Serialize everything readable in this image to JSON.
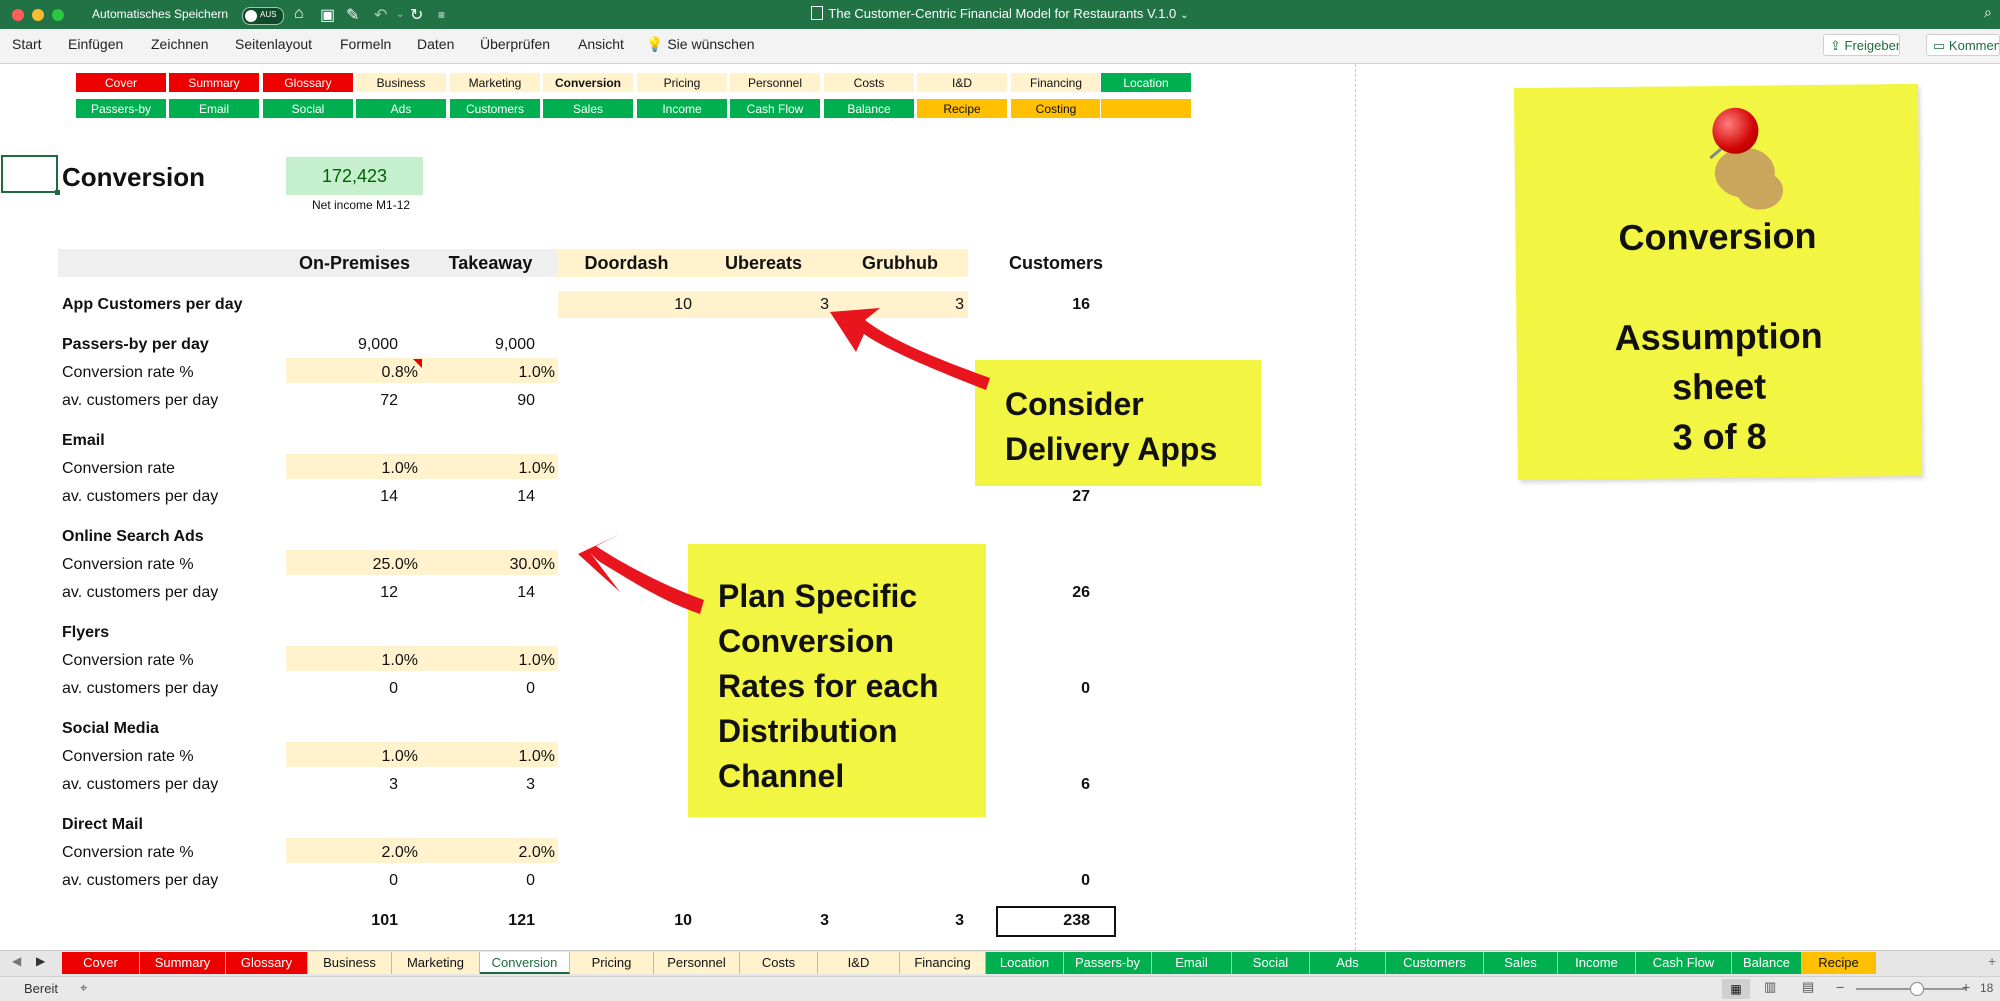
{
  "titlebar": {
    "autosave_label": "Automatisches Speichern",
    "autosave_state": "AUS",
    "doc_title": "The Customer-Centric Financial Model for Restaurants V.1.0"
  },
  "menubar": {
    "items": [
      "Start",
      "Einfügen",
      "Zeichnen",
      "Seitenlayout",
      "Formeln",
      "Daten",
      "Überprüfen",
      "Ansicht"
    ],
    "tell_me": "Sie wünschen",
    "share": "Freigeben",
    "comment": "Kommentare"
  },
  "nav": {
    "row1": [
      {
        "label": "Cover",
        "color": "red"
      },
      {
        "label": "Summary",
        "color": "red"
      },
      {
        "label": "Glossary",
        "color": "red"
      },
      {
        "label": "Business",
        "color": "beige"
      },
      {
        "label": "Marketing",
        "color": "beige"
      },
      {
        "label": "Conversion",
        "color": "beige"
      },
      {
        "label": "Pricing",
        "color": "beige"
      },
      {
        "label": "Personnel",
        "color": "beige"
      },
      {
        "label": "Costs",
        "color": "beige"
      },
      {
        "label": "I&D",
        "color": "beige"
      },
      {
        "label": "Financing",
        "color": "beige"
      },
      {
        "label": "Location",
        "color": "green"
      }
    ],
    "row2": [
      {
        "label": "Passers-by",
        "color": "green"
      },
      {
        "label": "Email",
        "color": "green"
      },
      {
        "label": "Social",
        "color": "green"
      },
      {
        "label": "Ads",
        "color": "green"
      },
      {
        "label": "Customers",
        "color": "green"
      },
      {
        "label": "Sales",
        "color": "green"
      },
      {
        "label": "Income",
        "color": "green"
      },
      {
        "label": "Cash Flow",
        "color": "green"
      },
      {
        "label": "Balance",
        "color": "green"
      },
      {
        "label": "Recipe",
        "color": "orange"
      },
      {
        "label": "Costing",
        "color": "orange"
      },
      {
        "label": "",
        "color": "orange"
      }
    ]
  },
  "sheet": {
    "title": "Conversion",
    "net_income_value": "172,423",
    "net_income_label": "Net income M1-12",
    "headers": [
      "On-Premises",
      "Takeaway",
      "Doordash",
      "Ubereats",
      "Grubhub",
      "Customers"
    ],
    "app_row": {
      "label": "App Customers per day",
      "doordash": "10",
      "ubereats": "3",
      "grubhub": "3",
      "customers": "16"
    },
    "sections": [
      {
        "name": "Passers-by per day",
        "name_values": [
          "9,000",
          "9,000"
        ],
        "rate_label": "Conversion rate %",
        "rates": [
          "0.8%",
          "1.0%"
        ],
        "avg_label": "av. customers per day",
        "avgs": [
          "72",
          "90"
        ],
        "customers": ""
      },
      {
        "name": "Email",
        "name_values": [
          "",
          ""
        ],
        "rate_label": "Conversion rate",
        "rates": [
          "1.0%",
          "1.0%"
        ],
        "avg_label": "av. customers per day",
        "avgs": [
          "14",
          "14"
        ],
        "customers": "27"
      },
      {
        "name": "Online Search Ads",
        "name_values": [
          "",
          ""
        ],
        "rate_label": "Conversion rate %",
        "rates": [
          "25.0%",
          "30.0%"
        ],
        "avg_label": "av. customers per day",
        "avgs": [
          "12",
          "14"
        ],
        "customers": "26"
      },
      {
        "name": "Flyers",
        "name_values": [
          "",
          ""
        ],
        "rate_label": "Conversion rate %",
        "rates": [
          "1.0%",
          "1.0%"
        ],
        "avg_label": "av. customers per day",
        "avgs": [
          "0",
          "0"
        ],
        "customers": "0"
      },
      {
        "name": "Social Media",
        "name_values": [
          "",
          ""
        ],
        "rate_label": "Conversion rate %",
        "rates": [
          "1.0%",
          "1.0%"
        ],
        "avg_label": "av. customers per day",
        "avgs": [
          "3",
          "3"
        ],
        "customers": "6"
      },
      {
        "name": "Direct Mail",
        "name_values": [
          "",
          ""
        ],
        "rate_label": "Conversion rate %",
        "rates": [
          "2.0%",
          "2.0%"
        ],
        "avg_label": "av. customers per day",
        "avgs": [
          "0",
          "0"
        ],
        "customers": "0"
      }
    ],
    "totals": {
      "on_premises": "101",
      "takeaway": "121",
      "doordash": "10",
      "ubereats": "3",
      "grubhub": "3",
      "customers": "238"
    }
  },
  "callouts": {
    "delivery": [
      "Consider",
      "Delivery Apps"
    ],
    "conversion": [
      "Plan Specific",
      "Conversion",
      "Rates for each",
      "Distribution",
      "Channel"
    ],
    "sticky": {
      "title": "Conversion",
      "line1": "Assumption",
      "line2": "sheet",
      "line3": "3 of 8"
    }
  },
  "sheet_tabs": [
    {
      "label": "Cover",
      "color": "red"
    },
    {
      "label": "Summary",
      "color": "red"
    },
    {
      "label": "Glossary",
      "color": "red"
    },
    {
      "label": "Business",
      "color": "beige"
    },
    {
      "label": "Marketing",
      "color": "beige"
    },
    {
      "label": "Conversion",
      "color": "active"
    },
    {
      "label": "Pricing",
      "color": "beige"
    },
    {
      "label": "Personnel",
      "color": "beige"
    },
    {
      "label": "Costs",
      "color": "beige"
    },
    {
      "label": "I&D",
      "color": "beige"
    },
    {
      "label": "Financing",
      "color": "beige"
    },
    {
      "label": "Location",
      "color": "green"
    },
    {
      "label": "Passers-by",
      "color": "green"
    },
    {
      "label": "Email",
      "color": "green"
    },
    {
      "label": "Social",
      "color": "green"
    },
    {
      "label": "Ads",
      "color": "green"
    },
    {
      "label": "Customers",
      "color": "green"
    },
    {
      "label": "Sales",
      "color": "green"
    },
    {
      "label": "Income",
      "color": "green"
    },
    {
      "label": "Cash Flow",
      "color": "green"
    },
    {
      "label": "Balance",
      "color": "green"
    },
    {
      "label": "Recipe",
      "color": "orange"
    }
  ],
  "status": {
    "ready": "Bereit",
    "zoom": "18"
  },
  "colors": {
    "excel_green": "#217346",
    "red": "#ef0000",
    "green": "#00b050",
    "beige": "#fff2cc",
    "orange": "#ffc000",
    "sticky": "#f2f542",
    "arrow": "#e8141e"
  }
}
